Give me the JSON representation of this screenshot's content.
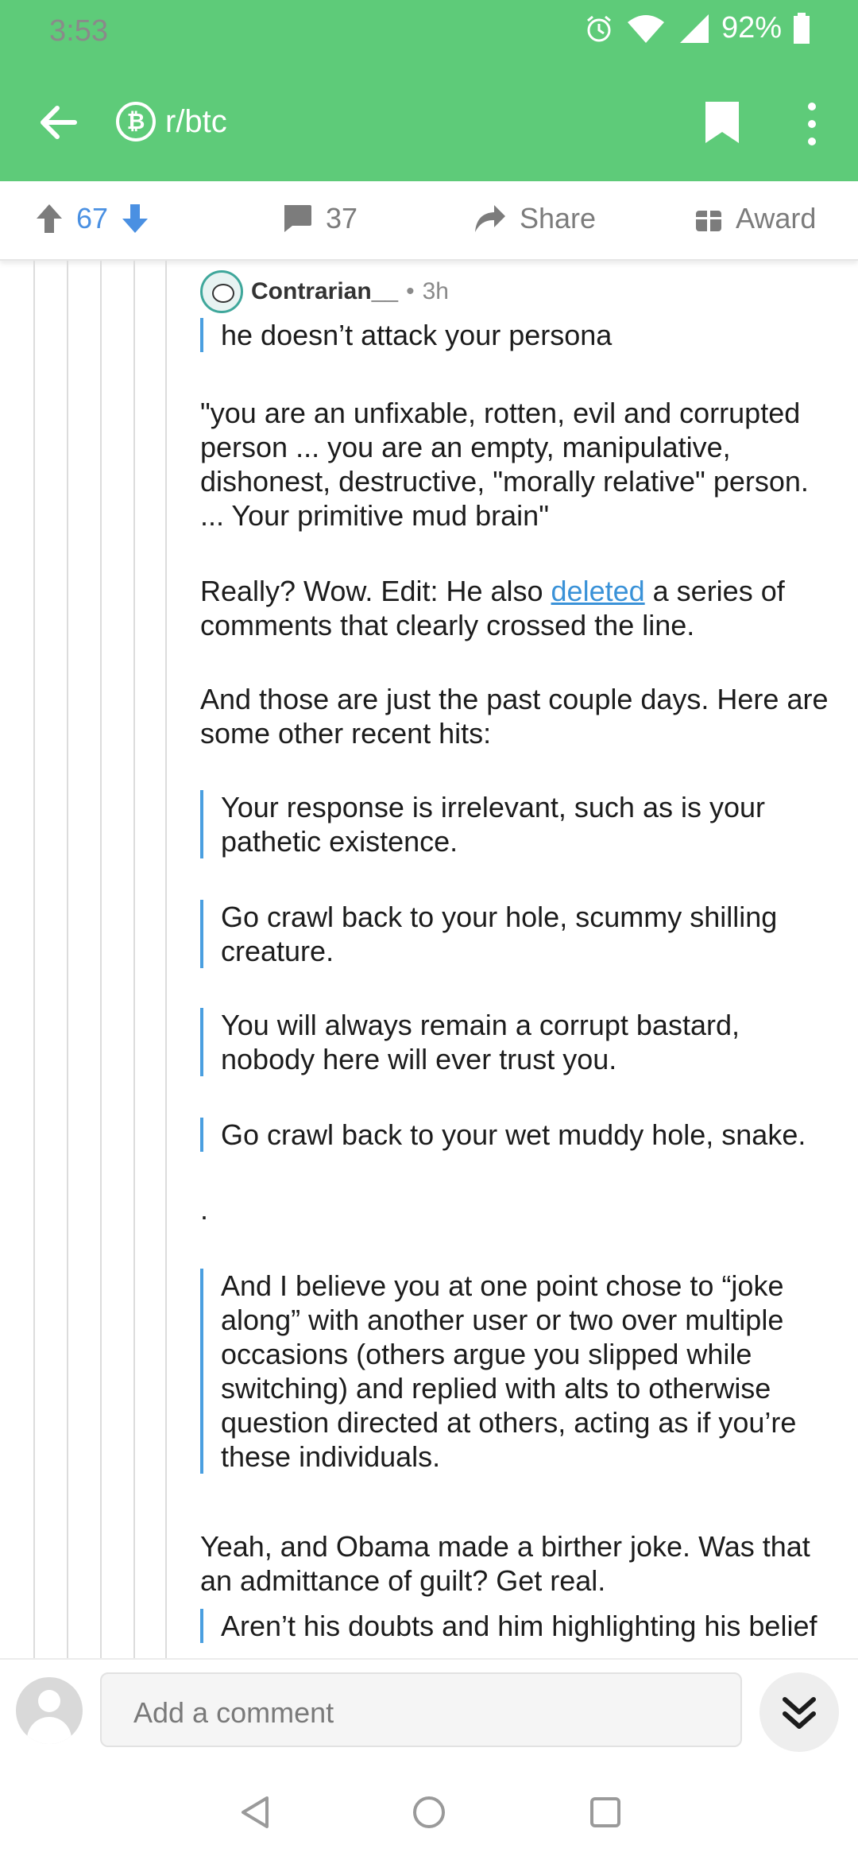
{
  "status_bar": {
    "time": "3:53",
    "battery": "92%",
    "icons": [
      "alarm-icon",
      "wifi-icon",
      "signal-icon",
      "battery-icon"
    ]
  },
  "app_bar": {
    "subreddit": "r/btc",
    "subreddit_icon": "bitcoin-icon"
  },
  "actions": {
    "score": "67",
    "comments": "37",
    "share": "Share",
    "award": "Award"
  },
  "comment": {
    "author": "Contrarian__",
    "separator": "•",
    "age": "3h",
    "quote_1": "he doesn’t attack your persona",
    "p1": "\"you are an unfixable, rotten, evil and corrupted person ...  you are an empty, manipulative, dishonest, destructive, \"morally relative\" person. ... Your primitive mud brain\"",
    "p2_before": "Really? Wow. Edit: He also ",
    "p2_link": "deleted",
    "p2_after": " a series of comments that clearly crossed the line.",
    "p3": "And those are just the past couple days. Here are some other recent hits:",
    "quote_2": "Your response is irrelevant, such as is your pathetic existence.",
    "quote_3": "Go crawl back to your hole, scummy shilling creature.",
    "quote_4": "You will always remain a corrupt bastard, nobody here will ever trust you.",
    "quote_5": "Go crawl back to your wet muddy hole, snake.",
    "dot": ".",
    "quote_6": "And I believe you at one point chose to “joke along” with another user or two over multiple occasions (others argue you slipped while switching) and replied with alts to otherwise question directed at others, acting as if you’re these individuals.",
    "p4": "Yeah, and Obama made a birther joke. Was that an admittance of guilt? Get real.",
    "quote_7": "Aren’t his doubts and him highlighting his belief"
  },
  "composer": {
    "placeholder": "Add a comment"
  },
  "colors": {
    "header_green": "#5ecb79",
    "upvote_blue": "#4a90e2",
    "quote_bar": "#4a9fe0",
    "link": "#3a92d8"
  }
}
